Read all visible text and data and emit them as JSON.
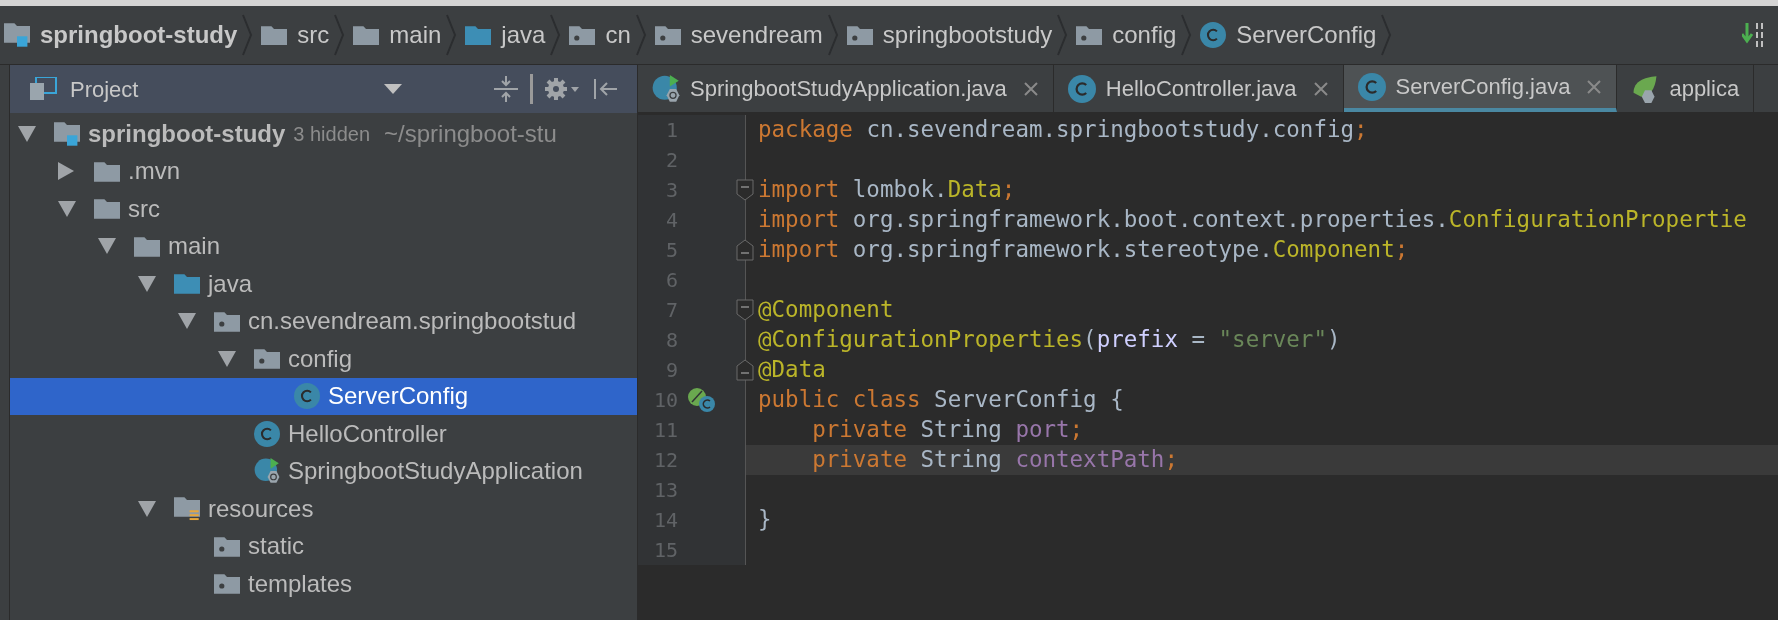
{
  "breadcrumbs": [
    {
      "label": "springboot-study",
      "kind": "module",
      "bold": true
    },
    {
      "label": "src",
      "kind": "folder",
      "bold": false
    },
    {
      "label": "main",
      "kind": "folder",
      "bold": false
    },
    {
      "label": "java",
      "kind": "source",
      "bold": false
    },
    {
      "label": "cn",
      "kind": "package",
      "bold": false
    },
    {
      "label": "sevendream",
      "kind": "package",
      "bold": false
    },
    {
      "label": "springbootstudy",
      "kind": "package",
      "bold": false
    },
    {
      "label": "config",
      "kind": "package",
      "bold": false
    },
    {
      "label": "ServerConfig",
      "kind": "class",
      "bold": false
    }
  ],
  "project_panel": {
    "title": "Project",
    "tree": [
      {
        "label": "springboot-study",
        "kind": "module",
        "note": "3 hidden",
        "path": "~/springboot-stu",
        "expanded": true,
        "selected": false,
        "children": [
          {
            "label": ".mvn",
            "kind": "folder",
            "expanded": false,
            "selected": false
          },
          {
            "label": "src",
            "kind": "folder",
            "expanded": true,
            "selected": false,
            "children": [
              {
                "label": "main",
                "kind": "folder",
                "expanded": true,
                "selected": false,
                "children": [
                  {
                    "label": "java",
                    "kind": "source",
                    "expanded": true,
                    "selected": false,
                    "children": [
                      {
                        "label": "cn.sevendream.springbootstud",
                        "kind": "package",
                        "expanded": true,
                        "selected": false,
                        "children": [
                          {
                            "label": "config",
                            "kind": "package",
                            "expanded": true,
                            "selected": false,
                            "children": [
                              {
                                "label": "ServerConfig",
                                "kind": "class",
                                "selected": true
                              }
                            ]
                          },
                          {
                            "label": "HelloController",
                            "kind": "class",
                            "selected": false
                          },
                          {
                            "label": "SpringbootStudyApplication",
                            "kind": "spring_app",
                            "selected": false
                          }
                        ]
                      }
                    ]
                  },
                  {
                    "label": "resources",
                    "kind": "resources",
                    "expanded": true,
                    "selected": false,
                    "children": [
                      {
                        "label": "static",
                        "kind": "package",
                        "selected": false
                      },
                      {
                        "label": "templates",
                        "kind": "package",
                        "selected": false
                      }
                    ]
                  }
                ]
              }
            ]
          }
        ]
      }
    ]
  },
  "tabs": [
    {
      "label": "SpringbootStudyApplication.java",
      "kind": "spring_app",
      "selected": false,
      "closable": true
    },
    {
      "label": "HelloController.java",
      "kind": "class",
      "selected": false,
      "closable": true
    },
    {
      "label": "ServerConfig.java",
      "kind": "class",
      "selected": true,
      "closable": true
    },
    {
      "label": "applica",
      "kind": "spring_config",
      "selected": false,
      "closable": false
    }
  ],
  "editor": {
    "lines": [
      {
        "number": "1",
        "current": false,
        "tokens": [
          {
            "t": "package ",
            "kind": "keyword"
          },
          {
            "t": "cn.sevendream.springbootstudy.config",
            "kind": "plain"
          },
          {
            "t": ";",
            "kind": "keyword"
          }
        ]
      },
      {
        "number": "2",
        "current": false
      },
      {
        "number": "3",
        "current": false,
        "markers": [
          {
            "kind": "fold_start"
          }
        ],
        "tokens": [
          {
            "t": "import ",
            "kind": "keyword"
          },
          {
            "t": "lombok.",
            "kind": "plain"
          },
          {
            "t": "Data",
            "kind": "annotation"
          },
          {
            "t": ";",
            "kind": "keyword"
          }
        ]
      },
      {
        "number": "4",
        "current": false,
        "tokens": [
          {
            "t": "import ",
            "kind": "keyword"
          },
          {
            "t": "org.springframework.boot.context.properties.",
            "kind": "plain"
          },
          {
            "t": "ConfigurationPropertie",
            "kind": "annotation"
          }
        ]
      },
      {
        "number": "5",
        "current": false,
        "markers": [
          {
            "kind": "fold_end"
          }
        ],
        "tokens": [
          {
            "t": "import ",
            "kind": "keyword"
          },
          {
            "t": "org.springframework.stereotype.",
            "kind": "plain"
          },
          {
            "t": "Component",
            "kind": "annotation"
          },
          {
            "t": ";",
            "kind": "keyword"
          }
        ]
      },
      {
        "number": "6",
        "current": false
      },
      {
        "number": "7",
        "current": false,
        "markers": [
          {
            "kind": "fold_start"
          }
        ],
        "tokens": [
          {
            "t": "@Component",
            "kind": "annotation"
          }
        ]
      },
      {
        "number": "8",
        "current": false,
        "tokens": [
          {
            "t": "@ConfigurationProperties",
            "kind": "annotation"
          },
          {
            "t": "(",
            "kind": "plain"
          },
          {
            "t": "prefix",
            "kind": "param"
          },
          {
            "t": " = ",
            "kind": "plain"
          },
          {
            "t": "\"server\"",
            "kind": "string"
          },
          {
            "t": ")",
            "kind": "plain"
          }
        ]
      },
      {
        "number": "9",
        "current": false,
        "markers": [
          {
            "kind": "fold_end"
          }
        ],
        "tokens": [
          {
            "t": "@Data",
            "kind": "annotation"
          }
        ]
      },
      {
        "number": "10",
        "current": false,
        "markers": [
          {
            "kind": "spring_bean"
          }
        ],
        "tokens": [
          {
            "t": "public class ",
            "kind": "keyword"
          },
          {
            "t": "ServerConfig {",
            "kind": "plain"
          }
        ]
      },
      {
        "number": "11",
        "current": false,
        "tokens": [
          {
            "t": "    private ",
            "kind": "keyword"
          },
          {
            "t": "String ",
            "kind": "plain"
          },
          {
            "t": "port",
            "kind": "field"
          },
          {
            "t": ";",
            "kind": "keyword"
          }
        ]
      },
      {
        "number": "12",
        "current": true,
        "tokens": [
          {
            "t": "    private ",
            "kind": "keyword"
          },
          {
            "t": "String ",
            "kind": "plain"
          },
          {
            "t": "contextPath",
            "kind": "field"
          },
          {
            "t": ";",
            "kind": "keyword"
          }
        ]
      },
      {
        "number": "13",
        "current": false
      },
      {
        "number": "14",
        "current": false,
        "tokens": [
          {
            "t": "}",
            "kind": "plain"
          }
        ]
      },
      {
        "number": "15",
        "current": false
      }
    ]
  }
}
